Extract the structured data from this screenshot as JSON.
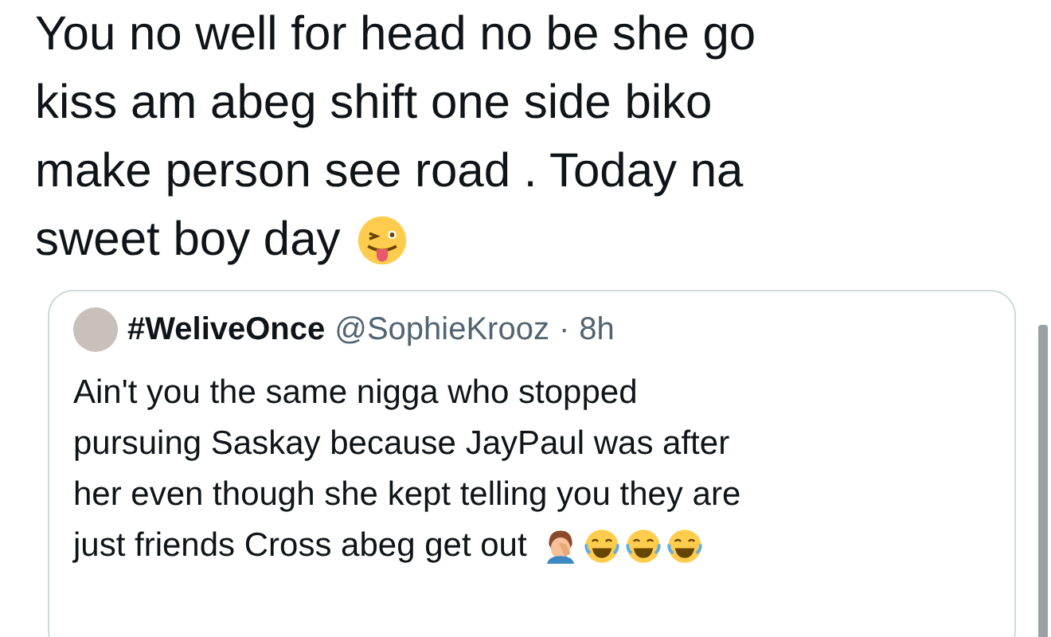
{
  "tweet": {
    "lines": [
      "You no well for head no be she go",
      "kiss am abeg shift one side biko",
      "make person see road . Today na",
      "sweet boy day"
    ]
  },
  "quoted_tweet": {
    "display_name": "#WeliveOnce",
    "handle": "@SophieKrooz",
    "separator": "·",
    "time": "8h",
    "lines": [
      "Ain't you the same nigga who stopped",
      "pursuing Saskay because JayPaul was after",
      "her even though she kept telling you they are",
      "just friends Cross abeg get out"
    ]
  }
}
